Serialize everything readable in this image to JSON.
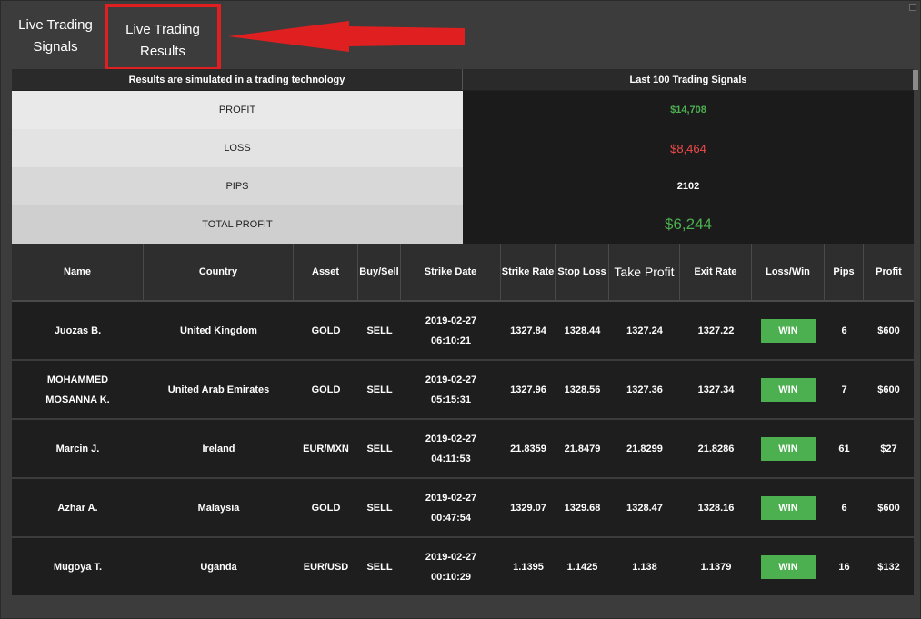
{
  "tabs": {
    "signals_line1": "Live Trading",
    "signals_line2": "Signals",
    "results_line1": "Live Trading",
    "results_line2": "Results"
  },
  "summary": {
    "left_header": "Results are simulated in a trading technology",
    "right_header": "Last 100 Trading Signals",
    "rows": [
      {
        "label": "PROFIT",
        "value": "$14,708",
        "color": "#4caf50"
      },
      {
        "label": "LOSS",
        "value": "$8,464",
        "color": "#f14a4a"
      },
      {
        "label": "PIPS",
        "value": "2102",
        "color": "#ffffff"
      },
      {
        "label": "TOTAL PROFIT",
        "value": "$6,244",
        "color": "#4caf50"
      }
    ]
  },
  "table": {
    "headers": {
      "name": "Name",
      "country": "Country",
      "asset": "Asset",
      "buysell": "Buy/Sell",
      "date": "Strike Date",
      "strike_rate": "Strike Rate",
      "stop_loss": "Stop Loss",
      "take_profit": "Take Profit",
      "exit_rate": "Exit Rate",
      "loss_win": "Loss/Win",
      "pips": "Pips",
      "profit": "Profit"
    },
    "rows": [
      {
        "name": "Juozas B.",
        "country": "United Kingdom",
        "asset": "GOLD",
        "buysell": "SELL",
        "date": "2019-02-27",
        "time": "06:10:21",
        "strike_rate": "1327.84",
        "stop_loss": "1328.44",
        "take_profit": "1327.24",
        "exit_rate": "1327.22",
        "result": "WIN",
        "pips": "6",
        "profit": "$600"
      },
      {
        "name": "MOHAMMED MOSANNA K.",
        "country": "United Arab Emirates",
        "asset": "GOLD",
        "buysell": "SELL",
        "date": "2019-02-27",
        "time": "05:15:31",
        "strike_rate": "1327.96",
        "stop_loss": "1328.56",
        "take_profit": "1327.36",
        "exit_rate": "1327.34",
        "result": "WIN",
        "pips": "7",
        "profit": "$600"
      },
      {
        "name": "Marcin J.",
        "country": "Ireland",
        "asset": "EUR/MXN",
        "buysell": "SELL",
        "date": "2019-02-27",
        "time": "04:11:53",
        "strike_rate": "21.8359",
        "stop_loss": "21.8479",
        "take_profit": "21.8299",
        "exit_rate": "21.8286",
        "result": "WIN",
        "pips": "61",
        "profit": "$27"
      },
      {
        "name": "Azhar A.",
        "country": "Malaysia",
        "asset": "GOLD",
        "buysell": "SELL",
        "date": "2019-02-27",
        "time": "00:47:54",
        "strike_rate": "1329.07",
        "stop_loss": "1329.68",
        "take_profit": "1328.47",
        "exit_rate": "1328.16",
        "result": "WIN",
        "pips": "6",
        "profit": "$600"
      },
      {
        "name": "Mugoya T.",
        "country": "Uganda",
        "asset": "EUR/USD",
        "buysell": "SELL",
        "date": "2019-02-27",
        "time": "00:10:29",
        "strike_rate": "1.1395",
        "stop_loss": "1.1425",
        "take_profit": "1.138",
        "exit_rate": "1.1379",
        "result": "WIN",
        "pips": "16",
        "profit": "$132"
      }
    ]
  },
  "colors": {
    "win": "#4caf50",
    "highlight_box": "#e02020"
  }
}
